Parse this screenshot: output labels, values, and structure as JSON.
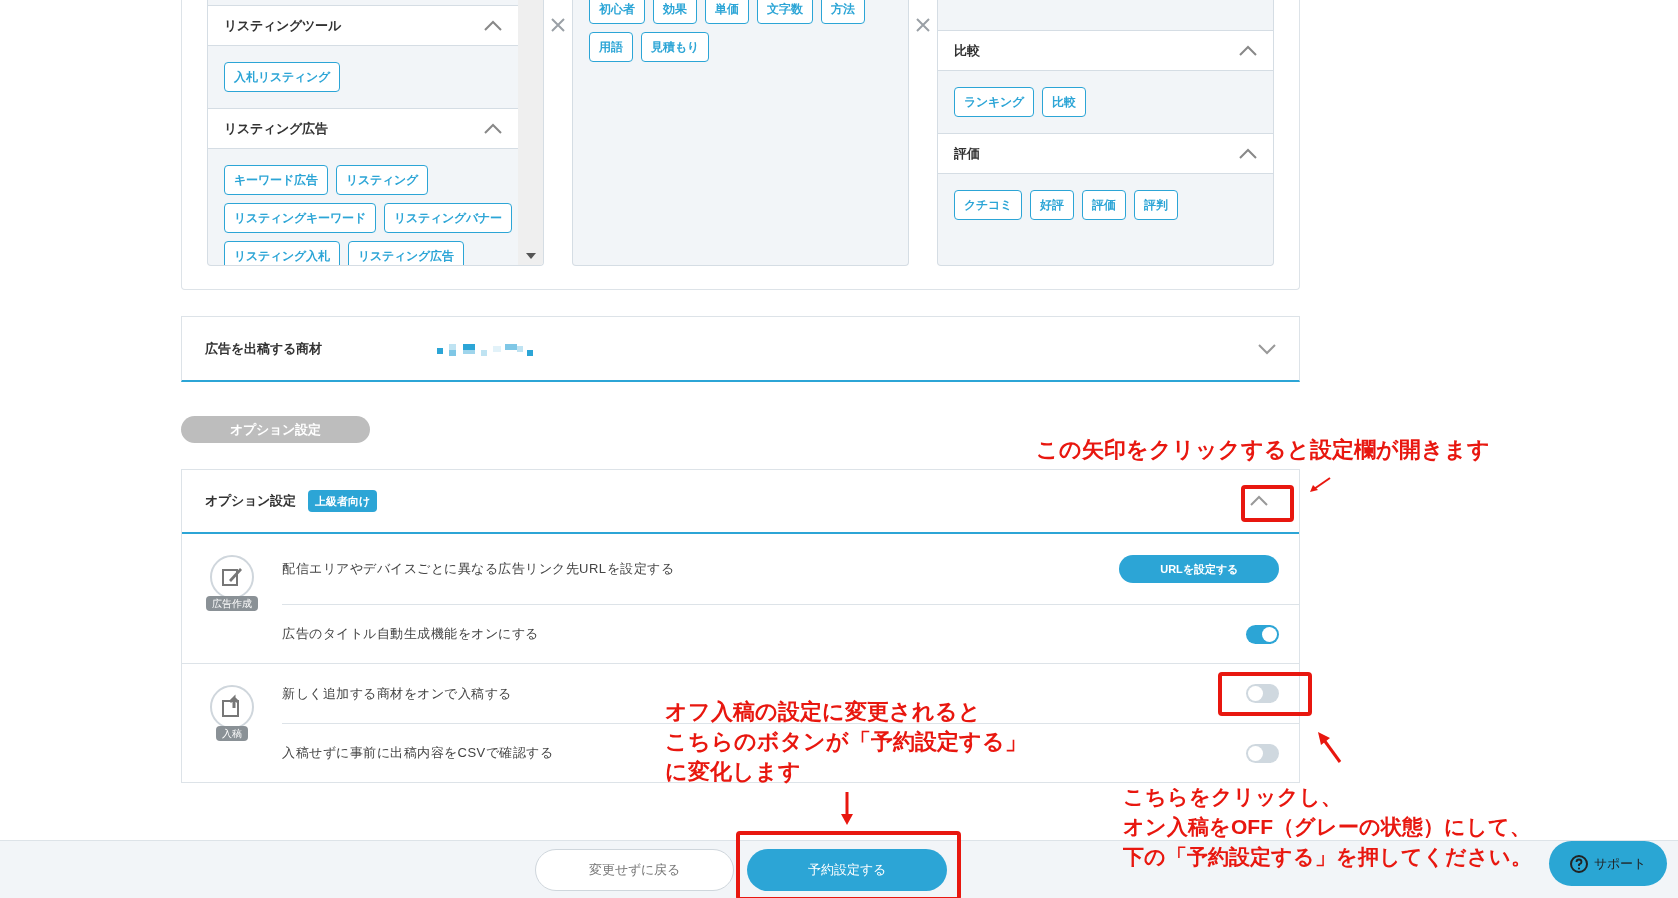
{
  "keyword_panel": {
    "columns": [
      {
        "scrollbar": true,
        "groups": [
          {
            "title": "リスティングツール",
            "expanded": true,
            "tags": [
              "入札リスティング"
            ]
          },
          {
            "title": "リスティング広告",
            "expanded": true,
            "tags": [
              "キーワード広告",
              "リスティング",
              "リスティングキーワード",
              "リスティングバナー",
              "リスティング入札",
              "リスティング広告"
            ]
          }
        ]
      },
      {
        "scrollbar": false,
        "groups": [
          {
            "tags": [
              "初心者",
              "効果",
              "単価",
              "文字数",
              "方法",
              "用語",
              "見積もり"
            ]
          }
        ]
      },
      {
        "scrollbar": false,
        "groups": [
          {
            "title": "比較",
            "expanded": true,
            "tags": [
              "ランキング",
              "比較"
            ]
          },
          {
            "title": "評価",
            "expanded": true,
            "tags": [
              "クチコミ",
              "好評",
              "評価",
              "評判"
            ]
          }
        ]
      }
    ]
  },
  "material_section": {
    "label": "広告を出稿する商材",
    "expanded": false
  },
  "option_pill": "オプション設定",
  "option_section": {
    "title": "オプション設定",
    "badge": "上級者向け",
    "expanded": true,
    "groups": [
      {
        "label": "広告作成",
        "rows": [
          {
            "kind": "button",
            "label": "配信エリアやデバイスごとに異なる広告リンク先URLを設定する",
            "button": "URLを設定する"
          },
          {
            "kind": "toggle",
            "label": "広告のタイトル自動生成機能をオンにする",
            "on": true
          }
        ]
      },
      {
        "label": "入稿",
        "rows": [
          {
            "kind": "toggle",
            "label": "新しく追加する商材をオンで入稿する",
            "on": false
          },
          {
            "kind": "toggle",
            "label": "入稿せずに事前に出稿内容をCSVで確認する",
            "on": false
          }
        ]
      }
    ]
  },
  "footer": {
    "buttons": [
      {
        "label": "変更せずに戻る",
        "kind": "secondary"
      },
      {
        "label": "予約設定する",
        "kind": "primary"
      }
    ],
    "support": "サポート"
  },
  "annotations": [
    {
      "lines": [
        "この矢印をクリックすると設定欄が開きます"
      ]
    },
    {
      "lines": [
        "オフ入稿の設定に変更されると",
        "こちらのボタンが「予約設定する」",
        "に変化します"
      ]
    },
    {
      "lines": [
        "こちらをクリックし、",
        "オン入稿をOFF（グレーの状態）にして、",
        "下の「予約設定する」を押してください。"
      ]
    }
  ]
}
